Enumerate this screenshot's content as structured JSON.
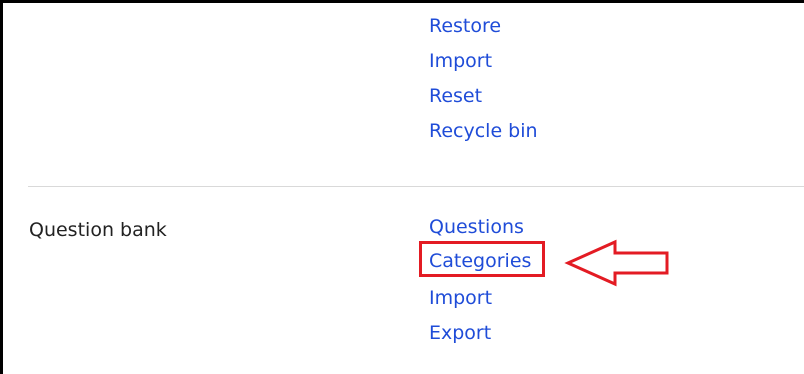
{
  "backup_section": {
    "links": [
      "Restore",
      "Import",
      "Reset",
      "Recycle bin"
    ]
  },
  "question_bank": {
    "label": "Question bank",
    "links": [
      "Questions",
      "Categories",
      "Import",
      "Export"
    ]
  },
  "annotation": {
    "highlight_color": "#e31b23",
    "pointer_icon": "left-arrow-icon"
  },
  "colors": {
    "link": "#1f4cd8",
    "text": "#222222",
    "divider": "#d9d9d9"
  }
}
